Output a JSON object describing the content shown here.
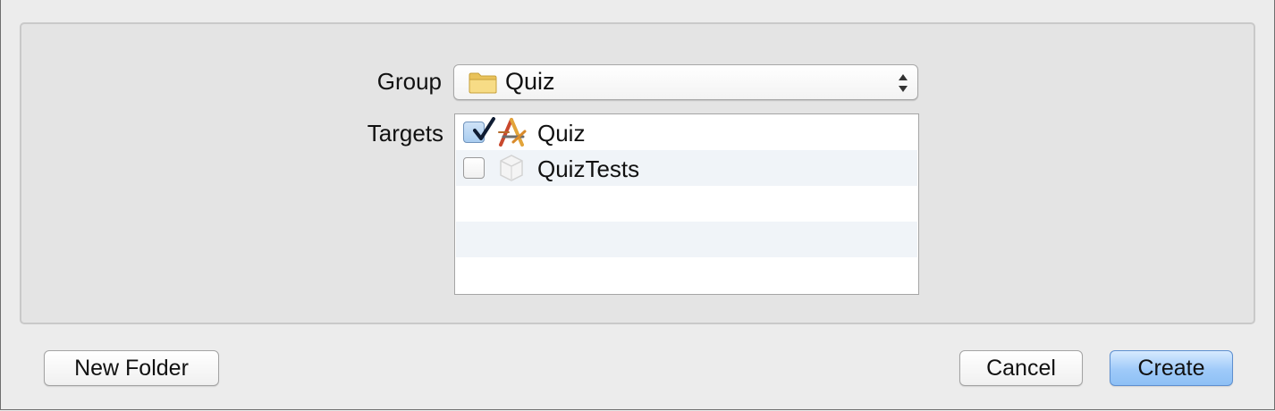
{
  "form": {
    "group_label": "Group",
    "group_value": "Quiz",
    "targets_label": "Targets"
  },
  "targets": [
    {
      "label": "Quiz",
      "checked": true,
      "icon": "app-target-icon"
    },
    {
      "label": "QuizTests",
      "checked": false,
      "icon": "test-bundle-icon"
    },
    {
      "label": "",
      "checked": null,
      "icon": ""
    },
    {
      "label": "",
      "checked": null,
      "icon": ""
    },
    {
      "label": "",
      "checked": null,
      "icon": ""
    }
  ],
  "buttons": {
    "new_folder": "New Folder",
    "cancel": "Cancel",
    "create": "Create"
  },
  "colors": {
    "default_button_accent": "#9fcaf9",
    "checkbox_checked": "#a9cdf0",
    "folder_yellow": "#f3d36b"
  }
}
